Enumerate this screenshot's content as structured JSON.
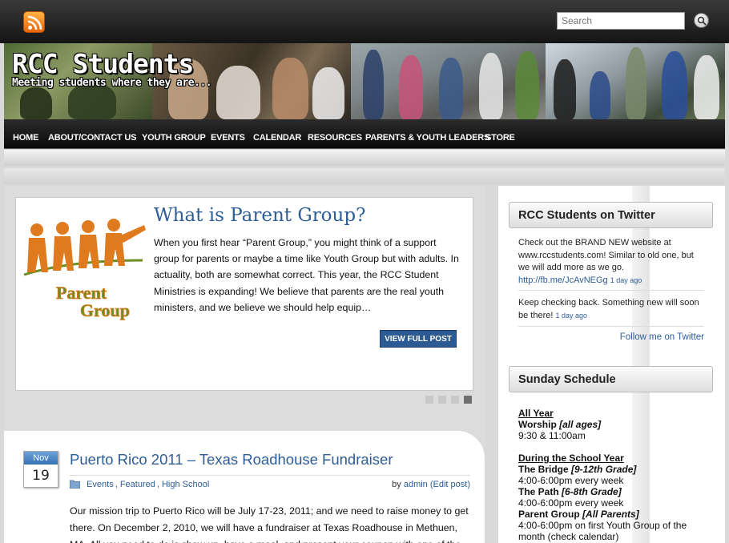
{
  "search": {
    "placeholder": "Search"
  },
  "header": {
    "title": "RCC Students",
    "tagline": "Meeting students where they are..."
  },
  "nav": {
    "items": [
      {
        "label": "HOME"
      },
      {
        "label": "ABOUT/CONTACT US"
      },
      {
        "label": "YOUTH GROUP"
      },
      {
        "label": "EVENTS"
      },
      {
        "label": "CALENDAR"
      },
      {
        "label": "RESOURCES"
      },
      {
        "label": "PARENTS & YOUTH LEADERS"
      },
      {
        "label": "STORE"
      }
    ]
  },
  "featured": {
    "logo_text_line1": "Parent",
    "logo_text_line2": "Group",
    "title": "What is Parent Group?",
    "excerpt": "When you first hear “Parent Group,” you might think of a support group for parents or maybe a time like Youth Group but with adults. In actuality, both are somewhat correct. This year, the RCC Student Ministries is expanding! We believe that parents are the real youth ministers, and we believe we should help equip…",
    "button": "VIEW FULL POST"
  },
  "post": {
    "month": "Nov",
    "day": "19",
    "title": "Puerto Rico 2011 – Texas Roadhouse Fundraiser",
    "categories": [
      "Events",
      "Featured",
      "High School"
    ],
    "by": "by",
    "author": "admin",
    "edit": "(Edit post)",
    "body": "Our mission trip to Puerto Rico will be July 17-23, 2011; and we need to raise money to get there. On December 2, 2010, we will have a fundraiser at Texas Roadhouse in Methuen, MA. All you need to do is show up, have a meal, and present your coupon with one of the"
  },
  "twitter": {
    "heading": "RCC Students on Twitter",
    "tweets": [
      {
        "text": "Check out the BRAND NEW website at www.rccstudents.com! Similar to old one, but we will add more as we go.",
        "link": "http://fb.me/JcAvNEGg",
        "ago": "1 day ago"
      },
      {
        "text": "Keep checking back. Something new will soon be there!",
        "ago": "1 day ago"
      }
    ],
    "follow": "Follow me on Twitter"
  },
  "schedule": {
    "heading": "Sunday Schedule",
    "all_year": "All Year",
    "worship": "Worship",
    "worship_tag": "[all ages]",
    "worship_time": "9:30 & 11:00am",
    "school_year": "During the School Year",
    "bridge": "The Bridge",
    "bridge_tag": "[9-12th Grade]",
    "bridge_time": "4:00-6:00pm every week",
    "path": "The Path",
    "path_tag": "[6-8th Grade]",
    "path_time": "4:00-6:00pm every week",
    "parent": "Parent Group",
    "parent_tag": "[All Parents]",
    "parent_time": "4:00-6:00pm on first Youth Group of the month (check calendar)"
  }
}
